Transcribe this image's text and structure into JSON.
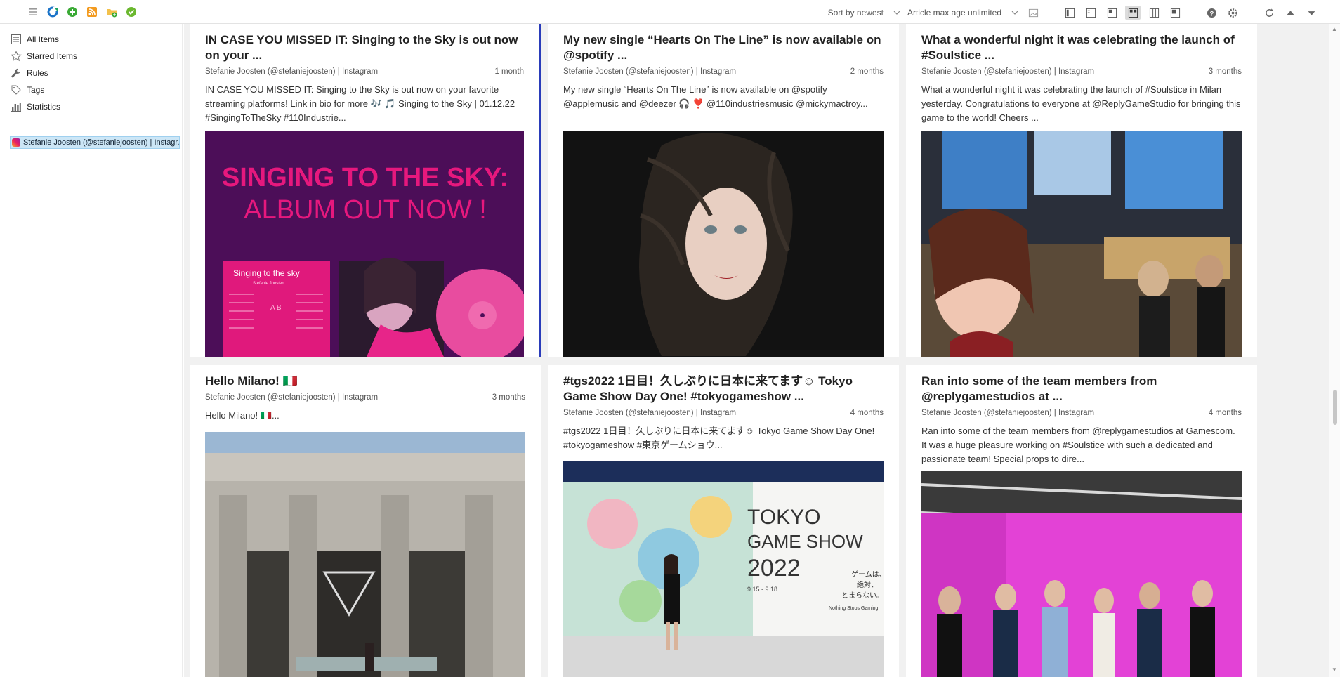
{
  "toolbar": {
    "sort_label": "Sort by newest",
    "age_label": "Article max age unlimited"
  },
  "sidebar": {
    "items": [
      {
        "label": "All Items",
        "icon": "list-icon"
      },
      {
        "label": "Starred Items",
        "icon": "star-icon"
      },
      {
        "label": "Rules",
        "icon": "wrench-icon"
      },
      {
        "label": "Tags",
        "icon": "tag-icon"
      },
      {
        "label": "Statistics",
        "icon": "bar-chart-icon"
      }
    ],
    "feed": "Stefanie Joosten (@stefaniejoosten) | Instagr..."
  },
  "articles": [
    {
      "title": "IN CASE YOU MISSED IT: Singing to the Sky is out now on your ...",
      "source": "Stefanie Joosten (@stefaniejoosten) | Instagram",
      "age": "1 month",
      "excerpt": "IN CASE YOU MISSED IT: Singing to the Sky is out now on your favorite streaming platforms! Link in bio for more 🎶 🎵 Singing to the Sky | 01.12.22 #SingingToTheSky #110Industrie...",
      "img_line1": "SINGING TO THE SKY:",
      "img_line2": "ALBUM OUT NOW !",
      "img_album": "Singing to the sky",
      "img_artist": "Stefanie Joosten",
      "img_ab": "A B"
    },
    {
      "title": "My new single “Hearts On The Line” is now available on @spotify ...",
      "source": "Stefanie Joosten (@stefaniejoosten) | Instagram",
      "age": "2 months",
      "excerpt": "My new single “Hearts On The Line” is now available on @spotify @applemusic and @deezer 🎧 ❣️ @110industriesmusic @mickymactroy..."
    },
    {
      "title": "What a wonderful night it was celebrating the launch of #Soulstice ...",
      "source": "Stefanie Joosten (@stefaniejoosten) | Instagram",
      "age": "3 months",
      "excerpt": "What a wonderful night it was celebrating the launch of #Soulstice in Milan yesterday. Congratulations to everyone at @ReplyGameStudio for bringing this game to the world! Cheers ..."
    },
    {
      "title": "Hello Milano! 🇮🇹",
      "source": "Stefanie Joosten (@stefaniejoosten) | Instagram",
      "age": "3 months",
      "excerpt": "Hello Milano! 🇮🇹..."
    },
    {
      "title": "#tgs2022 1日目！久しぶりに日本に来てます☺ Tokyo Game Show Day One! #tokyogameshow ...",
      "source": "Stefanie Joosten (@stefaniejoosten) | Instagram",
      "age": "4 months",
      "excerpt": "#tgs2022 1日目！久しぶりに日本に来てます☺ Tokyo Game Show Day One! #tokyogameshow #東京ゲームショウ...",
      "img_tgs1": "TOKYO",
      "img_tgs2": "GAME SHOW",
      "img_tgs3": "2022",
      "img_date": "9.15 - 9.18",
      "img_jp1": "ゲームは、",
      "img_jp2": "絶対、",
      "img_jp3": "とまらない。",
      "img_tag": "Nothing Stops Gaming"
    },
    {
      "title": "Ran into some of the team members from @replygamestudios at ...",
      "source": "Stefanie Joosten (@stefaniejoosten) | Instagram",
      "age": "4 months",
      "excerpt": "Ran into some of the team members from @replygamestudios at Gamescom. It was a huge pleasure working on #Soulstice with such a dedicated and passionate team! Special props to dire..."
    }
  ],
  "colors": {
    "accent": "#2a3cba",
    "feed_highlight": "#cce6f6",
    "album_purple": "#4a0f55",
    "album_pink": "#e6187d"
  }
}
